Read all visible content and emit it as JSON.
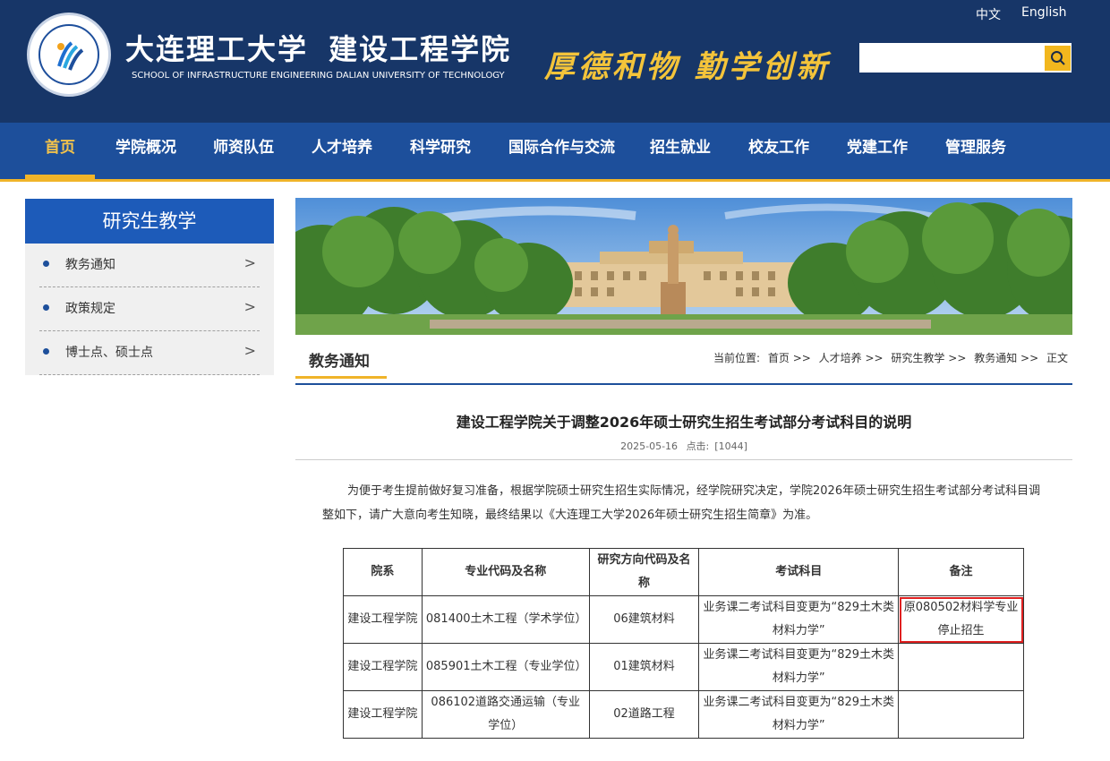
{
  "header": {
    "school_cn": "大连理工大学",
    "college_cn": "建设工程学院",
    "school_en": "SCHOOL OF INFRASTRUCTURE ENGINEERING DALIAN UNIVERSITY OF TECHNOLOGY",
    "motto": "厚德和物 勤学创新",
    "lang_zh": "中文",
    "lang_en": "English",
    "search_placeholder": "",
    "search_icon": "search-icon"
  },
  "nav": {
    "items": [
      "首页",
      "学院概况",
      "师资队伍",
      "人才培养",
      "科学研究",
      "国际合作与交流",
      "招生就业",
      "校友工作",
      "党建工作",
      "管理服务"
    ],
    "active_index": 0
  },
  "sidebar": {
    "title": "研究生教学",
    "items": [
      {
        "label": "教务通知",
        "arrow": ">"
      },
      {
        "label": "政策规定",
        "arrow": ">"
      },
      {
        "label": "博士点、硕士点",
        "arrow": ">"
      }
    ]
  },
  "section": {
    "title": "教务通知",
    "breadcrumb_prefix": "当前位置:",
    "breadcrumb": [
      "首页",
      ">>",
      "人才培养",
      ">>",
      "研究生教学",
      ">>",
      "教务通知",
      ">>",
      "正文"
    ]
  },
  "article": {
    "title": "建设工程学院关于调整2026年硕士研究生招生考试部分考试科目的说明",
    "date": "2025-05-16",
    "clicks_label": "点击:",
    "clicks": "[1044]",
    "body": "为便于考生提前做好复习准备，根据学院硕士研究生招生实际情况，经学院研究决定，学院2026年硕士研究生招生考试部分考试科目调整如下，请广大意向考生知晓，最终结果以《大连理工大学2026年硕士研究生招生简章》为准。"
  },
  "table": {
    "headers": [
      "院系",
      "专业代码及名称",
      "研究方向代码及名称",
      "考试科目",
      "备注"
    ],
    "rows": [
      [
        "建设工程学院",
        "081400土木工程（学术学位）",
        "06建筑材料",
        "业务课二考试科目变更为“829土木类材料力学”",
        "原080502材料学专业停止招生"
      ],
      [
        "建设工程学院",
        "085901土木工程（专业学位）",
        "01建筑材料",
        "业务课二考试科目变更为“829土木类材料力学”",
        ""
      ],
      [
        "建设工程学院",
        "086102道路交通运输（专业学位）",
        "02道路工程",
        "业务课二考试科目变更为“829土木类材料力学”",
        ""
      ]
    ]
  },
  "colors": {
    "header_bg": "#173668",
    "nav_bg": "#1d4f9b",
    "accent": "#f0b429",
    "sidebar_title_bg": "#1d5bb9",
    "highlight": "#e02020"
  }
}
